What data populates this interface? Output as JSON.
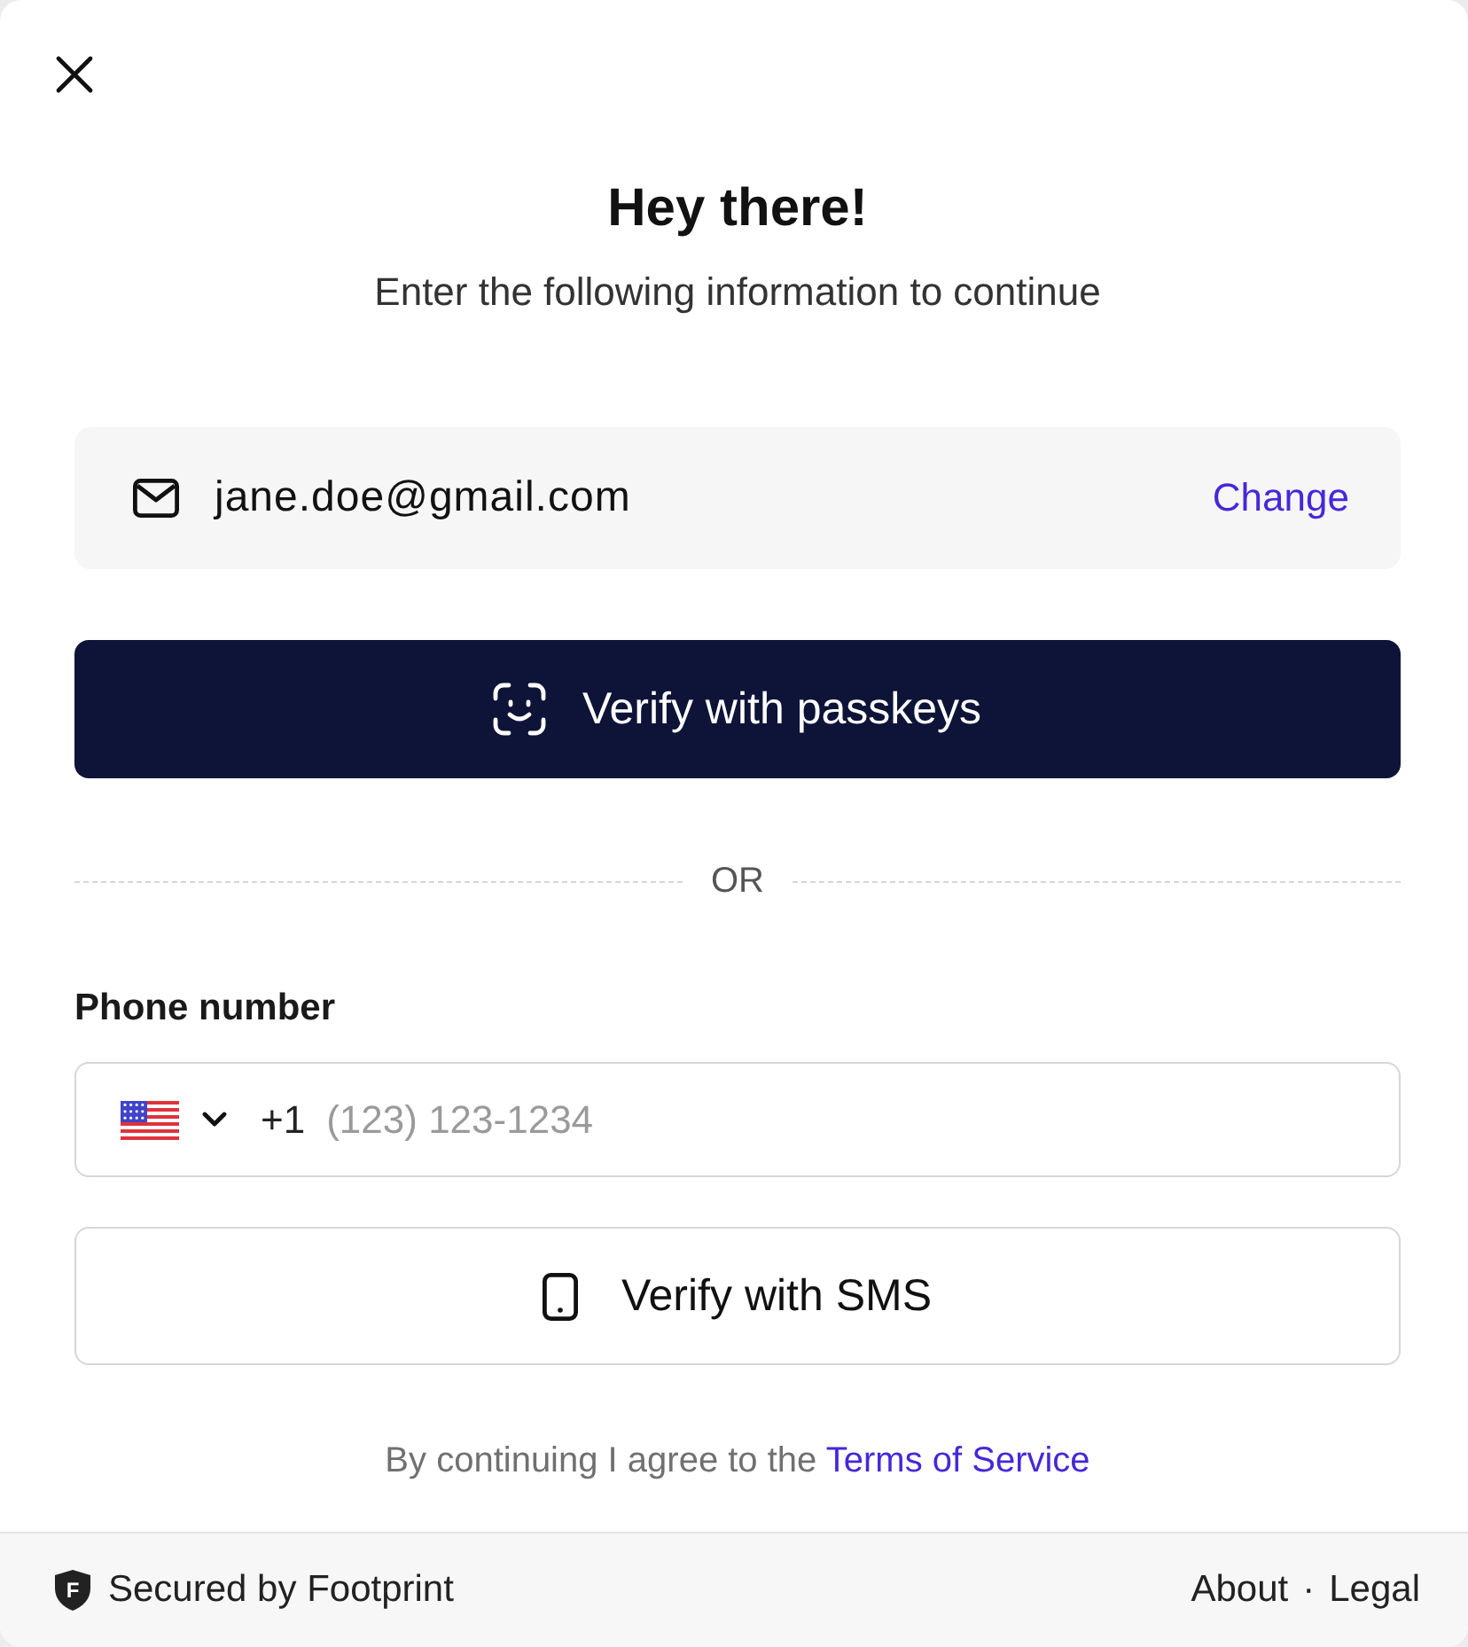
{
  "header": {
    "title": "Hey there!",
    "subtitle": "Enter the following information to continue"
  },
  "email": {
    "value": "jane.doe@gmail.com",
    "action": "Change"
  },
  "passkey_button": {
    "label": "Verify with passkeys"
  },
  "divider": {
    "label": "OR"
  },
  "phone": {
    "label": "Phone number",
    "dial_code": "+1",
    "placeholder": "(123) 123-1234"
  },
  "sms_button": {
    "label": "Verify with SMS"
  },
  "terms": {
    "text": "By continuing I agree to the",
    "link": "Terms of Service"
  },
  "footer": {
    "logo_letter": "F",
    "brand": "Secured by Footprint",
    "links": [
      "About",
      "Legal"
    ],
    "separator": "·"
  }
}
